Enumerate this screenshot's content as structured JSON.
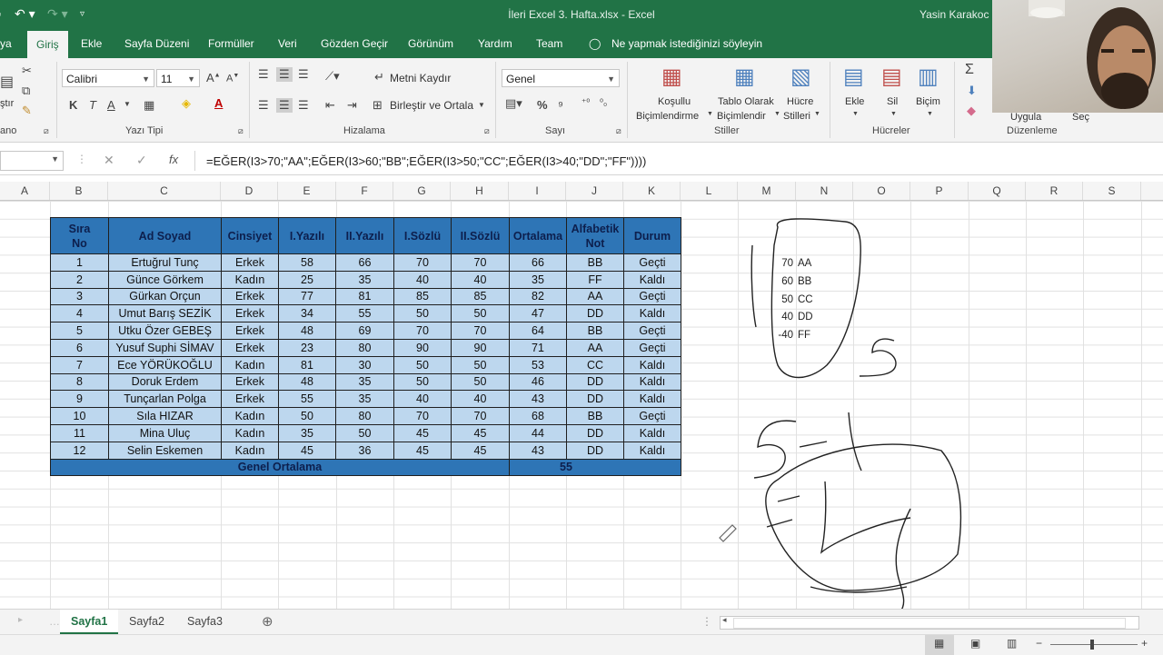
{
  "titlebar": {
    "file_title": "İleri Excel 3. Hafta.xlsx  -  Excel",
    "user": "Yasin Karakoc"
  },
  "tabs": [
    {
      "label": "ya"
    },
    {
      "label": "Giriş"
    },
    {
      "label": "Ekle"
    },
    {
      "label": "Sayfa Düzeni"
    },
    {
      "label": "Formüller"
    },
    {
      "label": "Veri"
    },
    {
      "label": "Gözden Geçir"
    },
    {
      "label": "Görünüm"
    },
    {
      "label": "Yardım"
    },
    {
      "label": "Team"
    }
  ],
  "tellme": "Ne yapmak istediğinizi söyleyin",
  "ribbon": {
    "font_name": "Calibri",
    "font_size": "11",
    "wrap_text": "Metni Kaydır",
    "merge_center": "Birleştir ve Ortala",
    "number_format": "Genel",
    "cond_format": [
      "Koşullu",
      "Biçimlendirme"
    ],
    "format_table": [
      "Tablo Olarak",
      "Biçimlendir"
    ],
    "cell_styles": [
      "Hücre",
      "Stilleri"
    ],
    "insert": "Ekle",
    "delete": "Sil",
    "format": "Biçim",
    "sort": "Uygula",
    "find": "Seç",
    "paste_partial": "ştır",
    "group_clipboard": "ano",
    "group_font": "Yazı Tipi",
    "group_align": "Hizalama",
    "group_number": "Sayı",
    "group_styles": "Stiller",
    "group_cells": "Hücreler",
    "group_editing": "Düzenleme",
    "bold": "K",
    "italic": "T",
    "underline": "A",
    "percent": "%"
  },
  "formula": "=EĞER(I3>70;\"AA\";EĞER(I3>60;\"BB\";EĞER(I3>50;\"CC\";EĞER(I3>40;\"DD\";\"FF\"))))",
  "fx": "fx",
  "columns": [
    "A",
    "B",
    "C",
    "D",
    "E",
    "F",
    "G",
    "H",
    "I",
    "J",
    "K",
    "L",
    "M",
    "N",
    "O",
    "P",
    "Q",
    "R",
    "S"
  ],
  "table": {
    "headers": [
      [
        "Sıra",
        "No"
      ],
      [
        "Ad Soyad"
      ],
      [
        "Cinsiyet"
      ],
      [
        "I.Yazılı"
      ],
      [
        "II.Yazılı"
      ],
      [
        "I.Sözlü"
      ],
      [
        "II.Sözlü"
      ],
      [
        "Ortalama"
      ],
      [
        "Alfabetik",
        "Not"
      ],
      [
        "Durum"
      ]
    ],
    "rows": [
      [
        "1",
        "Ertuğrul Tunç",
        "Erkek",
        "58",
        "66",
        "70",
        "70",
        "66",
        "BB",
        "Geçti"
      ],
      [
        "2",
        "Günce Görkem",
        "Kadın",
        "25",
        "35",
        "40",
        "40",
        "35",
        "FF",
        "Kaldı"
      ],
      [
        "3",
        "Gürkan Orçun",
        "Erkek",
        "77",
        "81",
        "85",
        "85",
        "82",
        "AA",
        "Geçti"
      ],
      [
        "4",
        "Umut Barış SEZİK",
        "Erkek",
        "34",
        "55",
        "50",
        "50",
        "47",
        "DD",
        "Kaldı"
      ],
      [
        "5",
        "Utku Özer GEBEŞ",
        "Erkek",
        "48",
        "69",
        "70",
        "70",
        "64",
        "BB",
        "Geçti"
      ],
      [
        "6",
        "Yusuf Suphi SİMAV",
        "Erkek",
        "23",
        "80",
        "90",
        "90",
        "71",
        "AA",
        "Geçti"
      ],
      [
        "7",
        "Ece YÖRÜKOĞLU",
        "Kadın",
        "81",
        "30",
        "50",
        "50",
        "53",
        "CC",
        "Kaldı"
      ],
      [
        "8",
        "Doruk Erdem",
        "Erkek",
        "48",
        "35",
        "50",
        "50",
        "46",
        "DD",
        "Kaldı"
      ],
      [
        "9",
        "Tunçarlan Polga",
        "Erkek",
        "55",
        "35",
        "40",
        "40",
        "43",
        "DD",
        "Kaldı"
      ],
      [
        "10",
        "Sıla HIZAR",
        "Kadın",
        "50",
        "80",
        "70",
        "70",
        "68",
        "BB",
        "Geçti"
      ],
      [
        "11",
        "Mina Uluç",
        "Kadın",
        "35",
        "50",
        "45",
        "45",
        "44",
        "DD",
        "Kaldı"
      ],
      [
        "12",
        "Selin Eskemen",
        "Kadın",
        "45",
        "36",
        "45",
        "45",
        "43",
        "DD",
        "Kaldı"
      ]
    ],
    "footer_label": "Genel Ortalama",
    "footer_value": "55"
  },
  "lookup": [
    {
      "score": "70",
      "grade": "AA"
    },
    {
      "score": "60",
      "grade": "BB"
    },
    {
      "score": "50",
      "grade": "CC"
    },
    {
      "score": "40",
      "grade": "DD"
    },
    {
      "score": "-40",
      "grade": "FF"
    }
  ],
  "sheets": [
    {
      "label": "Sayfa1"
    },
    {
      "label": "Sayfa2"
    },
    {
      "label": "Sayfa3"
    }
  ],
  "colors": {
    "excel_green": "#217346",
    "header_blue": "#2e75b6",
    "cell_blue": "#bdd7ee"
  }
}
